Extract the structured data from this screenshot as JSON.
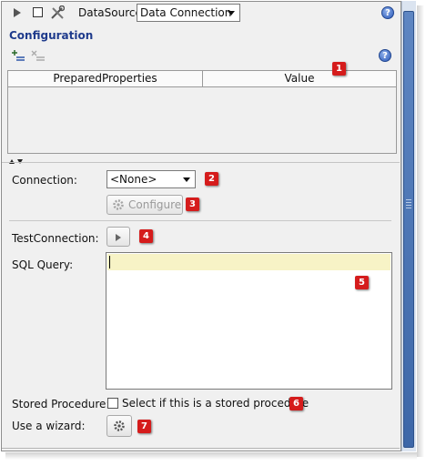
{
  "toolbar": {
    "datasource_label": "DataSource:",
    "datasource_value": "Data Connection",
    "help": "?"
  },
  "configuration": {
    "title": "Configuration",
    "help": "?"
  },
  "grid": {
    "columns": [
      "PreparedProperties",
      "Value"
    ]
  },
  "form": {
    "connection_label": "Connection:",
    "connection_value": "<None>",
    "configure_label": "Configure",
    "test_connection_label": "TestConnection:",
    "sql_query_label": "SQL Query:",
    "sql_query_value": "",
    "stored_procedure_label": "Stored Procedure:",
    "stored_procedure_checkbox_label": "Select if this is a stored procedure",
    "use_wizard_label": "Use a wizard:"
  },
  "badges": [
    "1",
    "2",
    "3",
    "4",
    "5",
    "6",
    "7"
  ],
  "colors": {
    "section_title": "#1f3b8c",
    "badge": "#d51c1c",
    "sql_highlight": "#f7f3c6",
    "scroll_thumb": "#4a74b4"
  }
}
